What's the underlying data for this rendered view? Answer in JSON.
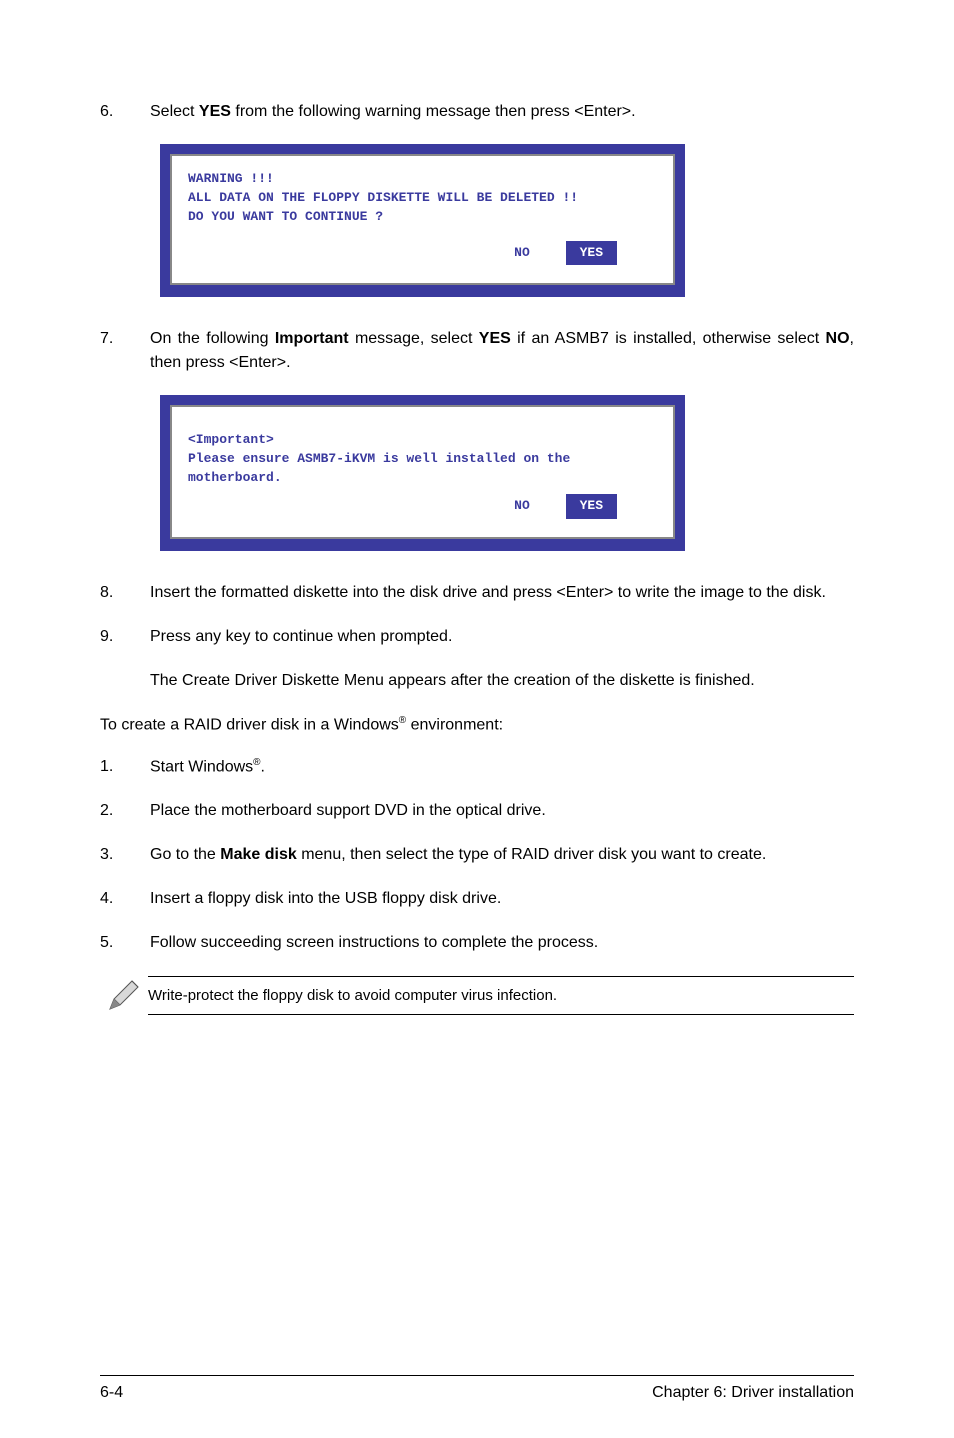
{
  "step6": {
    "num": "6.",
    "text_a": "Select ",
    "bold": "YES",
    "text_b": " from the following warning message then press <Enter>."
  },
  "dos1": {
    "line1": "WARNING !!!",
    "line2": "ALL DATA ON THE FLOPPY DISKETTE WILL BE DELETED !!",
    "line3": "DO YOU WANT TO CONTINUE ?",
    "no": "NO",
    "yes": "YES"
  },
  "step7": {
    "num": "7.",
    "text_a": "On the following ",
    "bold1": "Important",
    "text_b": " message, select ",
    "bold2": "YES",
    "text_c": " if an ASMB7 is installed, otherwise select ",
    "bold3": "NO",
    "text_d": ", then press <Enter>."
  },
  "dos2": {
    "line1": "<Important>",
    "line2": "Please ensure ASMB7-iKVM is well installed on the",
    "line3": "motherboard.",
    "no": "NO",
    "yes": "YES"
  },
  "step8": {
    "num": "8.",
    "text": "Insert the formatted diskette into the disk drive and press <Enter> to write the image to the disk."
  },
  "step9": {
    "num": "9.",
    "text": "Press any key to continue when prompted.",
    "after": "The Create Driver Diskette Menu appears after the creation of the diskette is finished."
  },
  "para": {
    "text_a": "To create a RAID driver disk in a Windows",
    "sup": "®",
    "text_b": " environment:"
  },
  "w1": {
    "num": "1.",
    "text_a": "Start Windows",
    "sup": "®",
    "text_b": "."
  },
  "w2": {
    "num": "2.",
    "text": "Place the motherboard support DVD in the optical drive."
  },
  "w3": {
    "num": "3.",
    "text_a": "Go to the ",
    "bold": "Make disk",
    "text_b": " menu, then select the type of RAID driver disk you want to create."
  },
  "w4": {
    "num": "4.",
    "text": "Insert a floppy disk into the USB floppy disk drive."
  },
  "w5": {
    "num": "5.",
    "text": "Follow succeeding screen instructions to complete the process."
  },
  "note": "Write-protect the floppy disk to avoid computer virus infection.",
  "footer": {
    "left": "6-4",
    "right": "Chapter 6: Driver installation"
  }
}
